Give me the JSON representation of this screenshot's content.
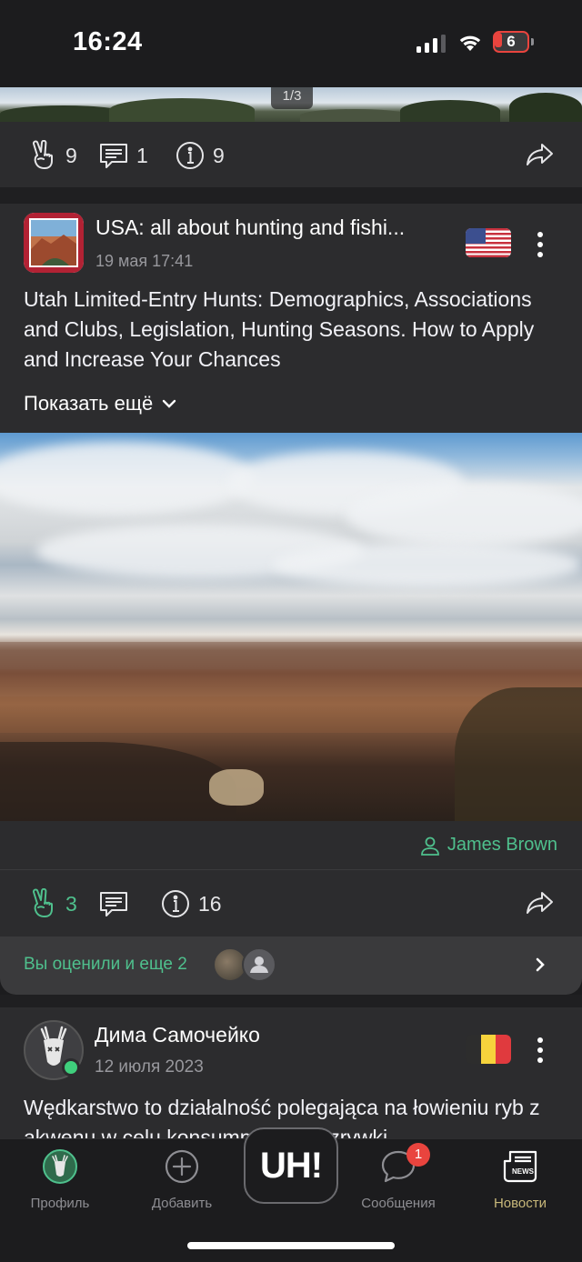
{
  "status_bar": {
    "time": "16:24",
    "battery": "6"
  },
  "gallery": {
    "pager": "1/3"
  },
  "post1_actions": {
    "likes": "9",
    "comments": "1",
    "views": "9"
  },
  "post2": {
    "group_title": "USA: all about hunting and fishi...",
    "date": "19 мая 17:41",
    "body": "Utah Limited-Entry Hunts: Demographics, Associations and Clubs, Legislation, Hunting Seasons. How to Apply and Increase Your Chances",
    "show_more": "Показать ещё",
    "photo_credit": "James Brown",
    "likes": "3",
    "views": "16",
    "liked_summary": "Вы оценили и еще 2"
  },
  "post3": {
    "author": "Дима Самочейко",
    "date": "12 июля 2023",
    "body": "Wędkarstwo to działalność polegająca na łowieniu ryb z akwenu w celu konsumpcji lub rozrywki"
  },
  "tabbar": {
    "profile": "Профиль",
    "add": "Добавить",
    "center": "UH!",
    "messages": "Сообщения",
    "messages_badge": "1",
    "news": "Новости"
  },
  "colors": {
    "accent_green": "#4fc08d",
    "active_tab": "#c8b87a",
    "badge_red": "#e9443e"
  }
}
